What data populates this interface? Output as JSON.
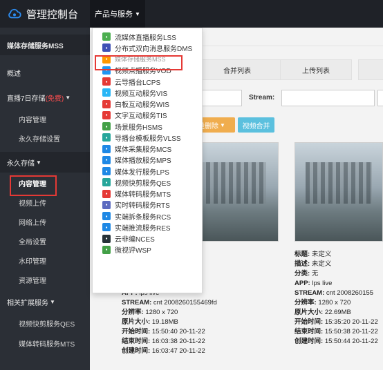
{
  "topbar": {
    "brand": "管理控制台",
    "active_menu": "产品与服务"
  },
  "sidebar": {
    "title": "媒体存储服务MSS",
    "items": [
      {
        "label": "概述"
      },
      {
        "label": "直播7日存储",
        "badge": "(免费)"
      },
      {
        "label": "内容管理"
      },
      {
        "label": "永久存储设置"
      },
      {
        "label": "永久存储"
      },
      {
        "label": "内容管理"
      },
      {
        "label": "视频上传"
      },
      {
        "label": "网络上传"
      },
      {
        "label": "全局设置"
      },
      {
        "label": "水印管理"
      },
      {
        "label": "资源管理"
      },
      {
        "label": "相关扩展服务"
      },
      {
        "label": "视频快剪服务QES"
      },
      {
        "label": "媒体转码服务MTS"
      }
    ]
  },
  "dropdown": {
    "items": [
      {
        "label": "流媒体直播服务LSS",
        "color": "#4caf50",
        "icon": "live-icon"
      },
      {
        "label": "分布式双向消息服务DMS",
        "color": "#3f51b5",
        "icon": "message-icon"
      },
      {
        "label": "媒体存储服务MSS",
        "color": "#ff9800",
        "icon": "storage-icon"
      },
      {
        "label": "视频点播服务VOD",
        "color": "#2196f3",
        "icon": "vod-icon"
      },
      {
        "label": "云导播台LCPS",
        "color": "#e53935",
        "icon": "director-icon"
      },
      {
        "label": "视频互动服务VIS",
        "color": "#29b6f6",
        "icon": "video-interact-icon"
      },
      {
        "label": "白板互动服务WIS",
        "color": "#e53935",
        "icon": "whiteboard-icon"
      },
      {
        "label": "文字互动服务TIS",
        "color": "#e53935",
        "icon": "text-icon"
      },
      {
        "label": "场景服务HSMS",
        "color": "#43a047",
        "icon": "scene-icon"
      },
      {
        "label": "导播台模板服务VLSS",
        "color": "#26a69a",
        "icon": "template-icon"
      },
      {
        "label": "媒体采集服务MCS",
        "color": "#1e88e5",
        "icon": "capture-icon"
      },
      {
        "label": "媒体播放服务MPS",
        "color": "#1e88e5",
        "icon": "play-icon"
      },
      {
        "label": "媒体发行服务LPS",
        "color": "#1e88e5",
        "icon": "distribute-icon"
      },
      {
        "label": "视频快剪服务QES",
        "color": "#26a69a",
        "icon": "clip-icon"
      },
      {
        "label": "媒体转码服务MTS",
        "color": "#e53935",
        "icon": "transcode-icon"
      },
      {
        "label": "实时转码服务RTS",
        "color": "#5c6bc0",
        "icon": "realtime-icon"
      },
      {
        "label": "实端拆条服务RCS",
        "color": "#1e88e5",
        "icon": "split-icon"
      },
      {
        "label": "实端推流服务RES",
        "color": "#1e88e5",
        "icon": "push-icon"
      },
      {
        "label": "云非编NCES",
        "color": "#263238",
        "icon": "edit-icon"
      },
      {
        "label": "微视评WSP",
        "color": "#43a047",
        "icon": "comment-icon"
      }
    ]
  },
  "main": {
    "tabs": [
      "合并列表",
      "上传列表"
    ],
    "stream_label": "Stream:",
    "batch_delete": "批量删除",
    "video_merge": "视频合并",
    "cards": [
      {
        "title_label": "",
        "title_value": "",
        "desc_label": "",
        "desc_value": "",
        "category_label": "",
        "category_value": "",
        "app_label": "APP:",
        "app_value": "lps  live",
        "stream_label": "STREAM:",
        "stream_value": "cnt  2008260155469fd",
        "resolution_label": "分辨率:",
        "resolution_value": "1280 x 720",
        "size_label": "原片大小:",
        "size_value": "19.18MB",
        "start_label": "开始时间:",
        "start_value": "15:50:40 20-11-22",
        "end_label": "结束时间:",
        "end_value": "16:03:38 20-11-22",
        "created_label": "创建时间:",
        "created_value": "16:03:47 20-11-22"
      },
      {
        "title_label": "标题:",
        "title_value": "未定义",
        "desc_label": "描述:",
        "desc_value": "未定义",
        "category_label": "分类:",
        "category_value": "无",
        "app_label": "APP:",
        "app_value": "lps  live",
        "stream_label": "STREAM:",
        "stream_value": "cnt  2008260155",
        "resolution_label": "分辨率:",
        "resolution_value": "1280 x 720",
        "size_label": "原片大小:",
        "size_value": "22.69MB",
        "start_label": "开始时间:",
        "start_value": "15:35:20 20-11-22",
        "end_label": "结束时间:",
        "end_value": "15:50:38 20-11-22",
        "created_label": "创建时间:",
        "created_value": "15:50:44 20-11-22"
      }
    ]
  }
}
